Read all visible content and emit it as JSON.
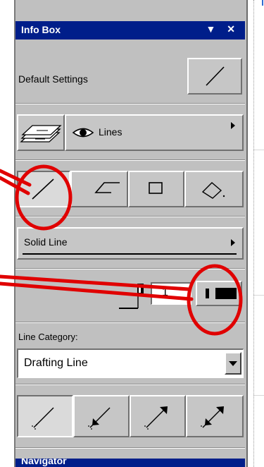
{
  "palette": {
    "title": "Info Box",
    "title_controls": "▼ ✕",
    "default_settings": "Default Settings",
    "layer": {
      "label": "Lines"
    },
    "geometry_methods": [
      "single-line",
      "polyline",
      "rectangle",
      "rotated-rectangle"
    ],
    "line_type": "Solid Line",
    "pen_number": "1",
    "line_category_label": "Line Category:",
    "line_category_value": "Drafting Line",
    "arrowhead_options": [
      "none",
      "start",
      "end",
      "both"
    ],
    "navigator_title": "Navigator"
  },
  "colors": {
    "title_bar": "#001e8a",
    "annotation_red": "#e00000",
    "panel": "#c0c0c0"
  }
}
